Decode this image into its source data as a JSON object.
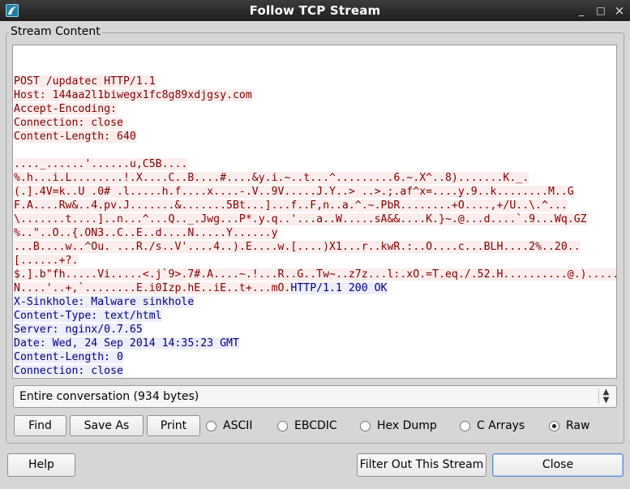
{
  "window": {
    "title": "Follow TCP Stream",
    "controls": {
      "minimize": "_",
      "maximize": "□",
      "close": "×"
    }
  },
  "group": {
    "title": "Stream Content"
  },
  "stream": {
    "lines": [
      {
        "dir": "client",
        "text": "POST /updatec HTTP/1.1"
      },
      {
        "dir": "client",
        "text": "Host: 144aa2l1biwegx1fc8g89xdjgsy.com"
      },
      {
        "dir": "client",
        "text": "Accept-Encoding:"
      },
      {
        "dir": "client",
        "text": "Connection: close"
      },
      {
        "dir": "client",
        "text": "Content-Length: 640"
      },
      {
        "dir": "client",
        "text": ""
      },
      {
        "dir": "client",
        "text": "...._......'......u,C5B...."
      },
      {
        "dir": "client",
        "text": "%.h...i.L........!.X....C..B....#....&y.i.~..t...^.........6.~.X^..8).......K._."
      },
      {
        "dir": "client",
        "text": "(.].4V=k..U .0# .l.....h.f....x....-.V..9V.....J.Y..> ..>.;.af^x=....y.9..k........M..G"
      },
      {
        "dir": "client",
        "text": "F.A....Rw&..4.pv.J.......&.......5Bt...]...f..F,n..a.^.~.PbR........+O....,+/U..\\.^..."
      },
      {
        "dir": "client",
        "text": "\\.......t....]..n...^...Q.._.Jwg...P*.y.q..'...a..W.....sA&&....K.}~.@...d....`.9...Wq.GZ"
      },
      {
        "dir": "client",
        "text": "%..\"..O..{.ON3..C..E..d....N.....Y......y"
      },
      {
        "dir": "client",
        "text": "...B....w..^Ou. ...R./s..V'....4..).E....w.[....)X1...r..kwR.:..O....c...BLH....2%..20.."
      },
      {
        "dir": "client",
        "text": "[......+?."
      },
      {
        "dir": "client",
        "text": "$.].b\"fh.....Vi.....<.j`9>.7#.A....~.!...R..G..Tw~..z7z...l:.xO.=T.eq./.52.H..........@.)....."
      },
      {
        "dir": "mixed",
        "client": "N....'..+,`........E.i0Izp.hE..iE..t+...mO.",
        "server": "HTTP/1.1 200 OK"
      },
      {
        "dir": "server",
        "text": "X-Sinkhole: Malware sinkhole"
      },
      {
        "dir": "server",
        "text": "Content-Type: text/html"
      },
      {
        "dir": "server",
        "text": "Server: nginx/0.7.65"
      },
      {
        "dir": "server",
        "text": "Date: Wed, 24 Sep 2014 14:35:23 GMT"
      },
      {
        "dir": "server",
        "text": "Content-Length: 0"
      },
      {
        "dir": "server",
        "text": "Connection: close"
      }
    ]
  },
  "conversation_select": {
    "value": "Entire conversation (934 bytes)"
  },
  "buttons": {
    "find": "Find",
    "save_as": "Save As",
    "print": "Print",
    "help": "Help",
    "filter_out": "Filter Out This Stream",
    "close": "Close"
  },
  "format_options": [
    {
      "label": "ASCII",
      "selected": false
    },
    {
      "label": "EBCDIC",
      "selected": false
    },
    {
      "label": "Hex Dump",
      "selected": false
    },
    {
      "label": "C Arrays",
      "selected": false
    },
    {
      "label": "Raw",
      "selected": true
    }
  ],
  "colors": {
    "client_bg": "#fbeded",
    "client_fg": "#7f0000",
    "server_bg": "#ededfb",
    "server_fg": "#00007f"
  }
}
